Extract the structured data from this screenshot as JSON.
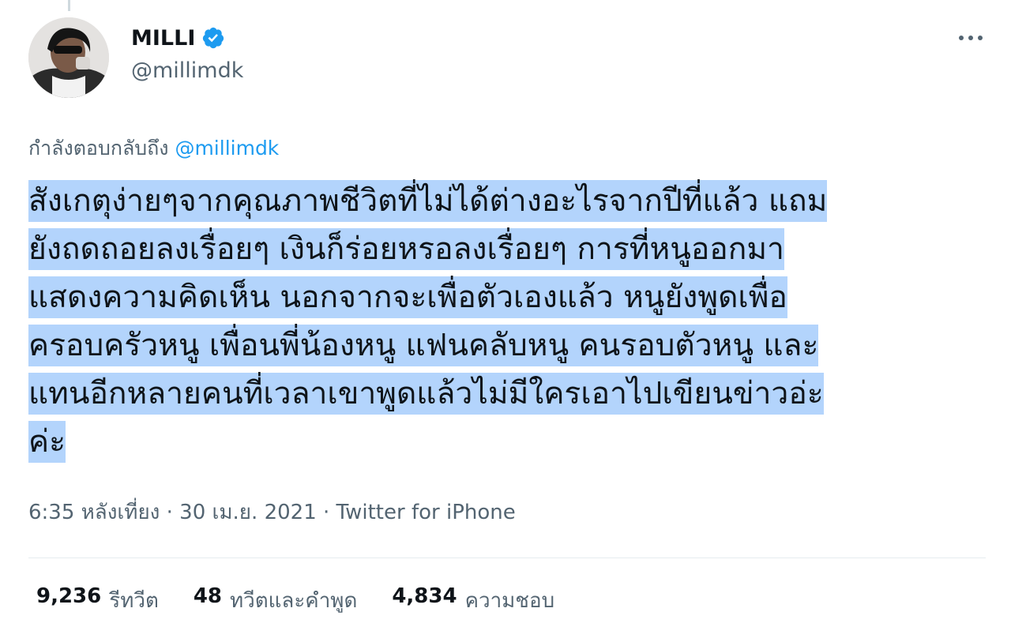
{
  "author": {
    "name": "MILLI",
    "handle": "@millimdk"
  },
  "reply_to": {
    "prefix": "กำลังตอบกลับถึง",
    "mention": "@millimdk"
  },
  "tweet": {
    "lines": [
      "สังเกตุง่ายๆจากคุณภาพชีวิตที่ไม่ได้ต่างอะไรจากปีที่แล้ว แถม",
      "ยังถดถอยลงเรื่อยๆ เงินก็ร่อยหรอลงเรื่อยๆ การที่หนูออกมา",
      "แสดงความคิดเห็น นอกจากจะเพื่อตัวเองแล้ว หนูยังพูดเพื่อ",
      "ครอบครัวหนู เพื่อนพี่น้องหนู แฟนคลับหนู คนรอบตัวหนู และ",
      "แทนอีกหลายคนที่เวลาเขาพูดแล้วไม่มีใครเอาไปเขียนข่าวอ่ะ",
      "ค่ะ"
    ]
  },
  "meta": {
    "time": "6:35 หลังเที่ยง",
    "sep": "·",
    "date": "30 เม.ย. 2021",
    "source": "Twitter for iPhone"
  },
  "stats": {
    "retweets": {
      "count": "9,236",
      "label": "รีทวีต"
    },
    "quotes": {
      "count": "48",
      "label": "ทวีตและคำพูด"
    },
    "likes": {
      "count": "4,834",
      "label": "ความชอบ"
    }
  },
  "colors": {
    "accent": "#1d9bf0",
    "secondary_text": "#536471",
    "highlight": "#b3d4fc"
  },
  "icons": {
    "verified": "verified-badge-icon",
    "more": "more-icon"
  }
}
